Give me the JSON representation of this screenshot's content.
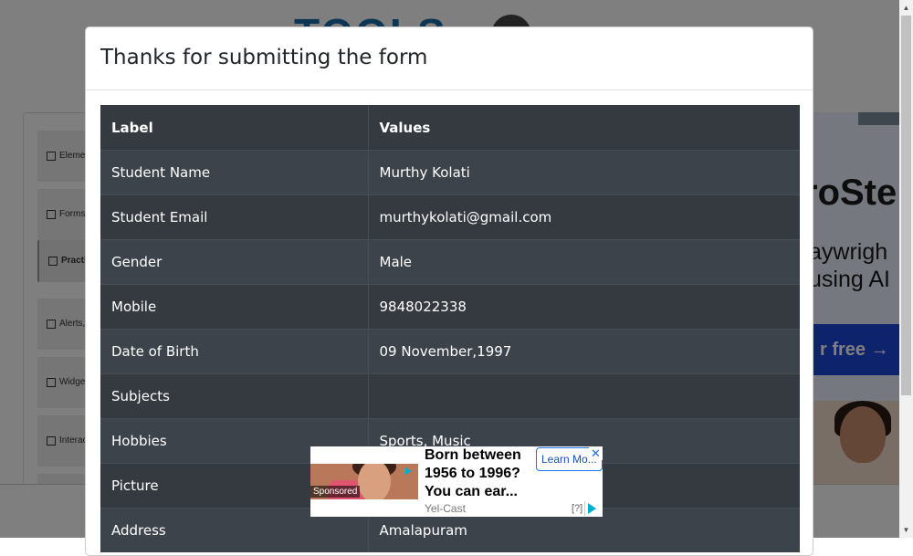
{
  "background": {
    "logo_text": "TOOLS",
    "sidebar_groups": [
      {
        "label": "Elements",
        "icon": "hamburger-icon"
      },
      {
        "label": "Forms",
        "icon": "document-icon"
      },
      {
        "label": "Practice Form",
        "icon": "html5-icon"
      },
      {
        "label": "Alerts, Frame & Windows",
        "icon": "window-icon"
      },
      {
        "label": "Widgets",
        "icon": "grid-icon"
      },
      {
        "label": "Interactions",
        "icon": "cursor-icon"
      }
    ],
    "right_ad": {
      "big_text": "roSte",
      "line1": "aywrigh",
      "line2": "using AI",
      "cta": "r free →"
    }
  },
  "modal": {
    "title": "Thanks for submitting the form",
    "table": {
      "headers": [
        "Label",
        "Values"
      ],
      "rows": [
        {
          "label": "Student Name",
          "value": "Murthy Kolati"
        },
        {
          "label": "Student Email",
          "value": "murthykolati@gmail.com"
        },
        {
          "label": "Gender",
          "value": "Male"
        },
        {
          "label": "Mobile",
          "value": "9848022338"
        },
        {
          "label": "Date of Birth",
          "value": "09 November,1997"
        },
        {
          "label": "Subjects",
          "value": ""
        },
        {
          "label": "Hobbies",
          "value": "Sports, Music"
        },
        {
          "label": "Picture",
          "value": ""
        },
        {
          "label": "Address",
          "value": "Amalapuram"
        }
      ]
    }
  },
  "ad": {
    "sponsored": "Sponsored",
    "headline": "Born between 1956 to 1996? You can ear...",
    "source": "Yel-Cast",
    "cta": "Learn Mo...",
    "close_glyph": "✕",
    "help": "[?]"
  },
  "colors": {
    "table_dark": "#343a40",
    "table_stripe": "#3d434a",
    "table_border": "#454d55",
    "backdrop": "rgba(0,0,0,0.5)"
  }
}
